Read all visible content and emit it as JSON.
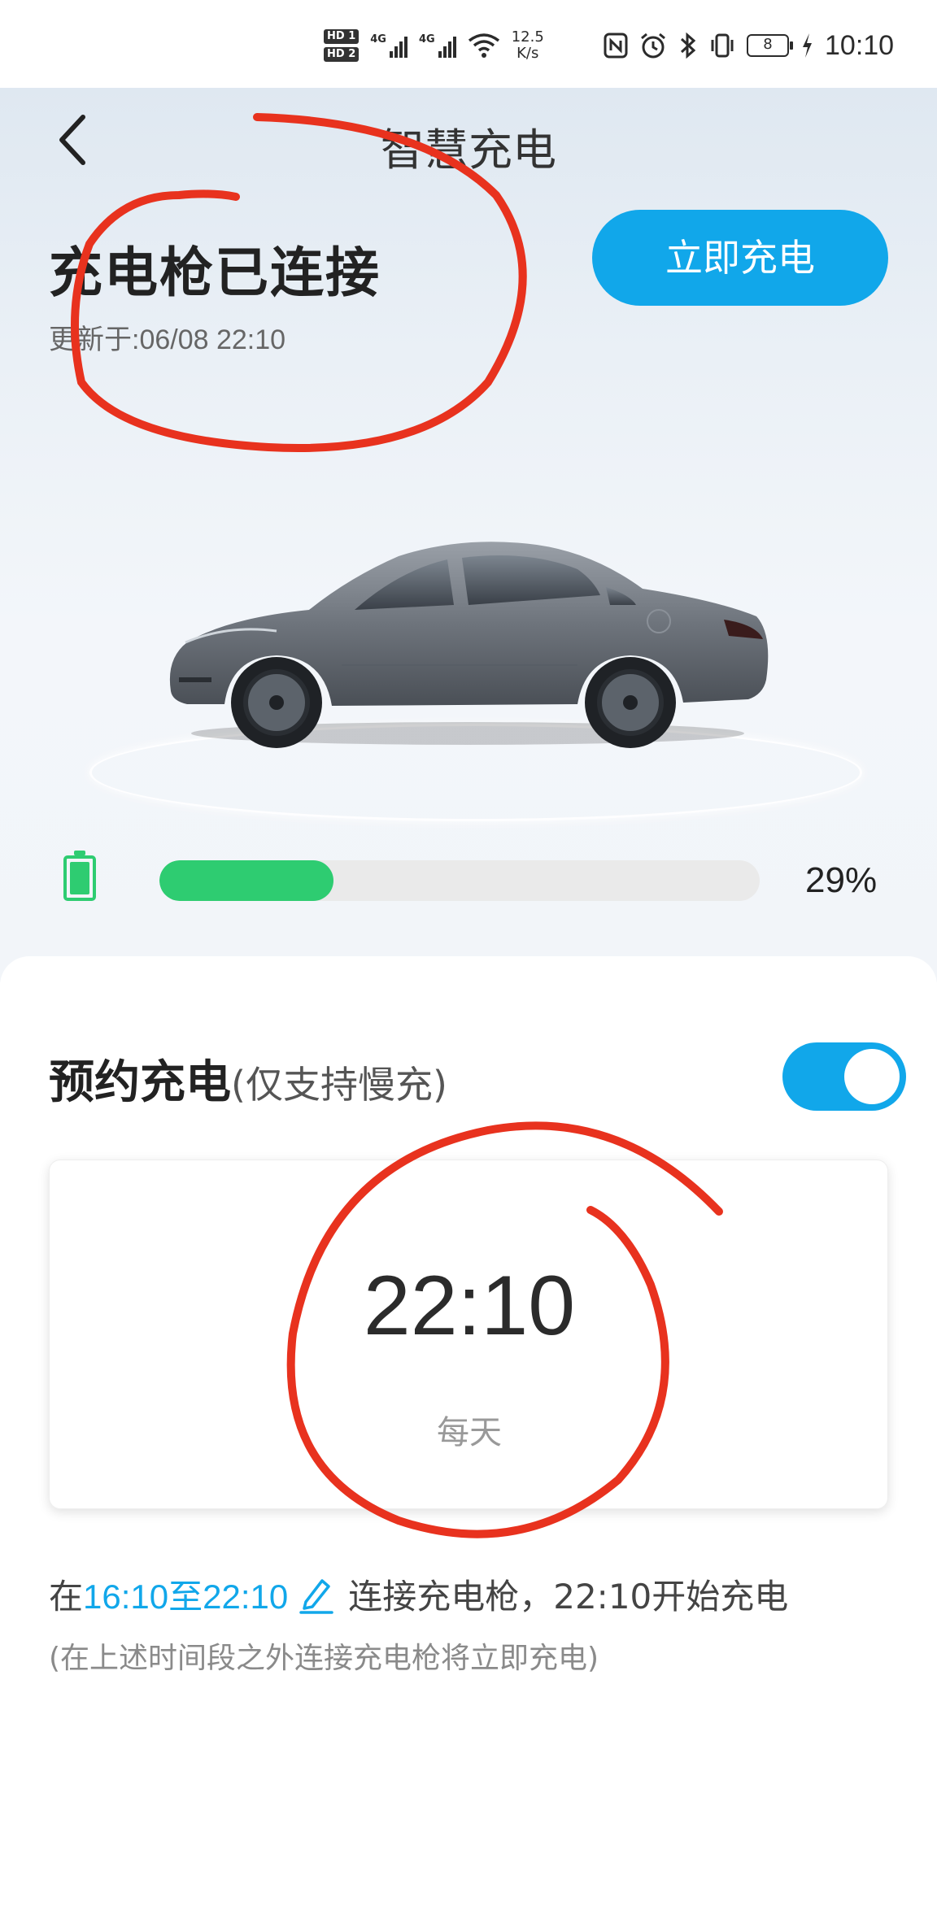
{
  "status_bar": {
    "hd1": "HD 1",
    "hd2": "HD 2",
    "net1": "4G",
    "net2": "4G",
    "speed_value": "12.5",
    "speed_unit": "K/s",
    "battery_level": "8",
    "time": "10:10",
    "icons": [
      "nfc-icon",
      "alarm-icon",
      "bluetooth-icon",
      "vibrate-icon",
      "battery-icon",
      "charging-bolt-icon",
      "wifi-icon",
      "signal-icon"
    ]
  },
  "header": {
    "title": "智慧充电"
  },
  "charge_status": {
    "title": "充电枪已连接",
    "updated": "更新于:06/08 22:10",
    "charge_now_label": "立即充电"
  },
  "battery": {
    "percent_label": "29%",
    "level_fraction": 0.29
  },
  "schedule": {
    "title": "预约充电",
    "subtitle": "(仅支持慢充)",
    "enabled": true,
    "time": "22:10",
    "repeat": "每天",
    "window_prefix": "在",
    "window_range": "16:10至22:10",
    "window_suffix": "连接充电枪，22:10开始充电",
    "note": "(在上述时间段之外连接充电枪将立即充电)"
  },
  "colors": {
    "accent": "#11a7ea",
    "battery_green": "#2ecc71",
    "annotation_red": "#e8321e"
  }
}
